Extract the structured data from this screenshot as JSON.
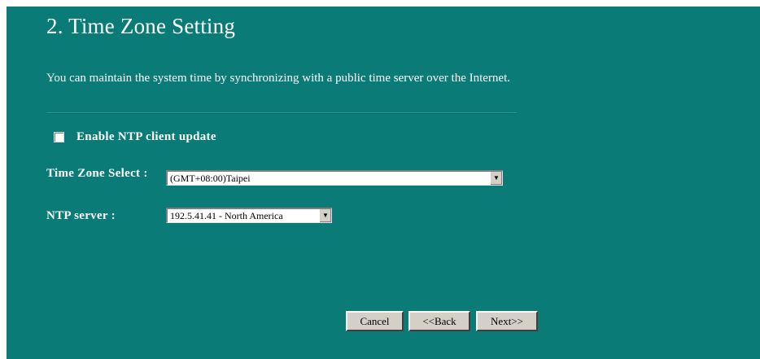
{
  "page": {
    "title": "2. Time Zone Setting",
    "description": "You can maintain the system time by synchronizing with a public time server over the Internet."
  },
  "ntp": {
    "enable_label": "Enable NTP client update",
    "enabled": false
  },
  "timezone": {
    "label": "Time Zone Select :",
    "selected": "(GMT+08:00)Taipei"
  },
  "ntp_server": {
    "label": "NTP server :",
    "selected": "192.5.41.41 - North America"
  },
  "buttons": {
    "cancel": "Cancel",
    "back": "<<Back",
    "next": "Next>>"
  },
  "colors": {
    "background": "#0a7b77",
    "text": "#ffffff",
    "button_face": "#d4d0c8"
  }
}
